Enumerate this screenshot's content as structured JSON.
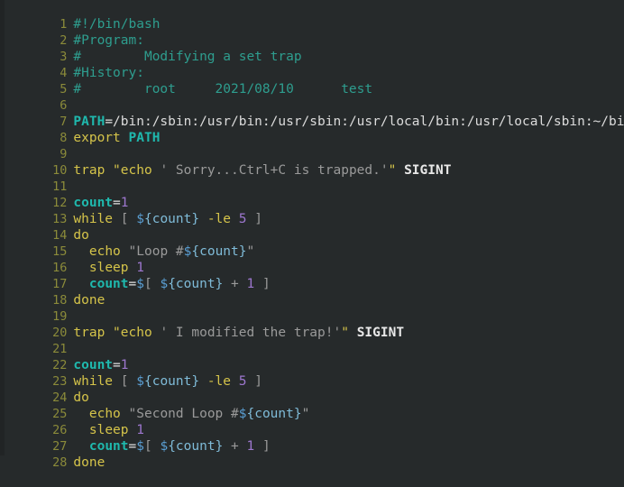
{
  "editor": {
    "background_color": "#262a2b",
    "gutter_color": "#212425",
    "line_number_color": "#8b8b3a",
    "default_text_color": "#d0d0d0",
    "language": "bash",
    "total_lines": 28,
    "first_visible_line": 1,
    "last_visible_line": 28
  },
  "palette": {
    "comment": "#2e9e8f",
    "keyword": "#d5c44a",
    "variable": "#1fb8ad",
    "variable_reference": "#7fbbd8",
    "dollar": "#5a9fd4",
    "string": "#9a9a9a",
    "quote": "#d5c44a",
    "number": "#9d77cf",
    "plain": "#d8d8d8",
    "punctuation": "#9a9a9a"
  },
  "lines": [
    {
      "n": "1",
      "text": "#!/bin/bash"
    },
    {
      "n": "2",
      "text": "#Program:"
    },
    {
      "n": "3",
      "text": "#        Modifying a set trap"
    },
    {
      "n": "4",
      "text": "#History:"
    },
    {
      "n": "5",
      "text": "#        root     2021/08/10      test"
    },
    {
      "n": "6",
      "text": ""
    },
    {
      "n": "7",
      "text": "PATH=/bin:/sbin:/usr/bin:/usr/sbin:/usr/local/bin:/usr/local/sbin:~/bin"
    },
    {
      "n": "8",
      "text": "export PATH"
    },
    {
      "n": "9",
      "text": ""
    },
    {
      "n": "10",
      "text": "trap \"echo ' Sorry...Ctrl+C is trapped.'\" SIGINT"
    },
    {
      "n": "11",
      "text": ""
    },
    {
      "n": "12",
      "text": "count=1"
    },
    {
      "n": "13",
      "text": "while [ ${count} -le 5 ]"
    },
    {
      "n": "14",
      "text": "do"
    },
    {
      "n": "15",
      "text": "  echo \"Loop #${count}\""
    },
    {
      "n": "16",
      "text": "  sleep 1"
    },
    {
      "n": "17",
      "text": "  count=$[ ${count} + 1 ]"
    },
    {
      "n": "18",
      "text": "done"
    },
    {
      "n": "19",
      "text": ""
    },
    {
      "n": "20",
      "text": "trap \"echo ' I modified the trap!'\" SIGINT"
    },
    {
      "n": "21",
      "text": ""
    },
    {
      "n": "22",
      "text": "count=1"
    },
    {
      "n": "23",
      "text": "while [ ${count} -le 5 ]"
    },
    {
      "n": "24",
      "text": "do"
    },
    {
      "n": "25",
      "text": "  echo \"Second Loop #${count}\""
    },
    {
      "n": "26",
      "text": "  sleep 1"
    },
    {
      "n": "27",
      "text": "  count=$[ ${count} + 1 ]"
    },
    {
      "n": "28",
      "text": "done"
    }
  ],
  "tokens": {
    "l1": {
      "comment": "#!/bin/bash"
    },
    "l2": {
      "comment": "#Program:"
    },
    "l3": {
      "comment": "#        Modifying a set trap"
    },
    "l4": {
      "comment": "#History:"
    },
    "l5": {
      "comment": "#        root     2021/08/10      test"
    },
    "l7": {
      "var": "PATH",
      "eq": "=",
      "value": "/bin:/sbin:/usr/bin:/usr/sbin:/usr/local/bin:/usr/local/sbin:~/bin"
    },
    "l8": {
      "keyword": "export",
      "space": " ",
      "var": "PATH"
    },
    "l10": {
      "keyword": "trap",
      "space": " ",
      "dq_open": "\"",
      "cmd": "echo ",
      "body": "' Sorry...Ctrl+C is trapped.'",
      "dq_close": "\"",
      "space2": " ",
      "signal": "SIGINT"
    },
    "l12": {
      "var": "count",
      "eq": "=",
      "num": "1"
    },
    "l13": {
      "keyword": "while",
      "space": " ",
      "br_open": "[ ",
      "dollar": "$",
      "ref": "{count}",
      "op": " -le ",
      "num": "5",
      "br_close": " ]"
    },
    "l14": {
      "keyword": "do"
    },
    "l15": {
      "indent": "  ",
      "keyword": "echo",
      "space": " ",
      "dq_open": "\"",
      "str": "Loop #",
      "dollar": "$",
      "ref": "{count}",
      "dq_close": "\""
    },
    "l16": {
      "indent": "  ",
      "keyword": "sleep",
      "space": " ",
      "num": "1"
    },
    "l17": {
      "indent": "  ",
      "var": "count",
      "eq": "=",
      "dollar": "$",
      "br_open": "[ ",
      "dollar2": "$",
      "ref": "{count}",
      "op": " + ",
      "num": "1",
      "br_close": " ]"
    },
    "l18": {
      "keyword": "done"
    },
    "l20": {
      "keyword": "trap",
      "space": " ",
      "dq_open": "\"",
      "cmd": "echo ",
      "body": "' I modified the trap!'",
      "dq_close": "\"",
      "space2": " ",
      "signal": "SIGINT"
    },
    "l22": {
      "var": "count",
      "eq": "=",
      "num": "1"
    },
    "l23": {
      "keyword": "while",
      "space": " ",
      "br_open": "[ ",
      "dollar": "$",
      "ref": "{count}",
      "op": " -le ",
      "num": "5",
      "br_close": " ]"
    },
    "l24": {
      "keyword": "do"
    },
    "l25": {
      "indent": "  ",
      "keyword": "echo",
      "space": " ",
      "dq_open": "\"",
      "str": "Second Loop #",
      "dollar": "$",
      "ref": "{count}",
      "dq_close": "\""
    },
    "l26": {
      "indent": "  ",
      "keyword": "sleep",
      "space": " ",
      "num": "1"
    },
    "l27": {
      "indent": "  ",
      "var": "count",
      "eq": "=",
      "dollar": "$",
      "br_open": "[ ",
      "dollar2": "$",
      "ref": "{count}",
      "op": " + ",
      "num": "1",
      "br_close": " ]"
    },
    "l28": {
      "keyword": "done"
    }
  }
}
